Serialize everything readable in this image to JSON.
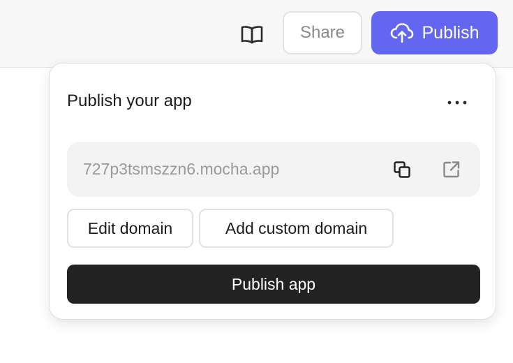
{
  "header": {
    "docs_icon": "book-open-icon",
    "share_label": "Share",
    "publish_label": "Publish",
    "publish_icon": "cloud-upload-icon",
    "accent_color": "#6366f1"
  },
  "popover": {
    "title": "Publish your app",
    "more_icon": "more-horizontal-icon",
    "url": "727p3tsmszzn6.mocha.app",
    "copy_icon": "copy-icon",
    "open_icon": "external-link-icon",
    "edit_domain_label": "Edit domain",
    "add_custom_domain_label": "Add custom domain",
    "publish_app_label": "Publish app",
    "publish_app_color": "#222222"
  }
}
